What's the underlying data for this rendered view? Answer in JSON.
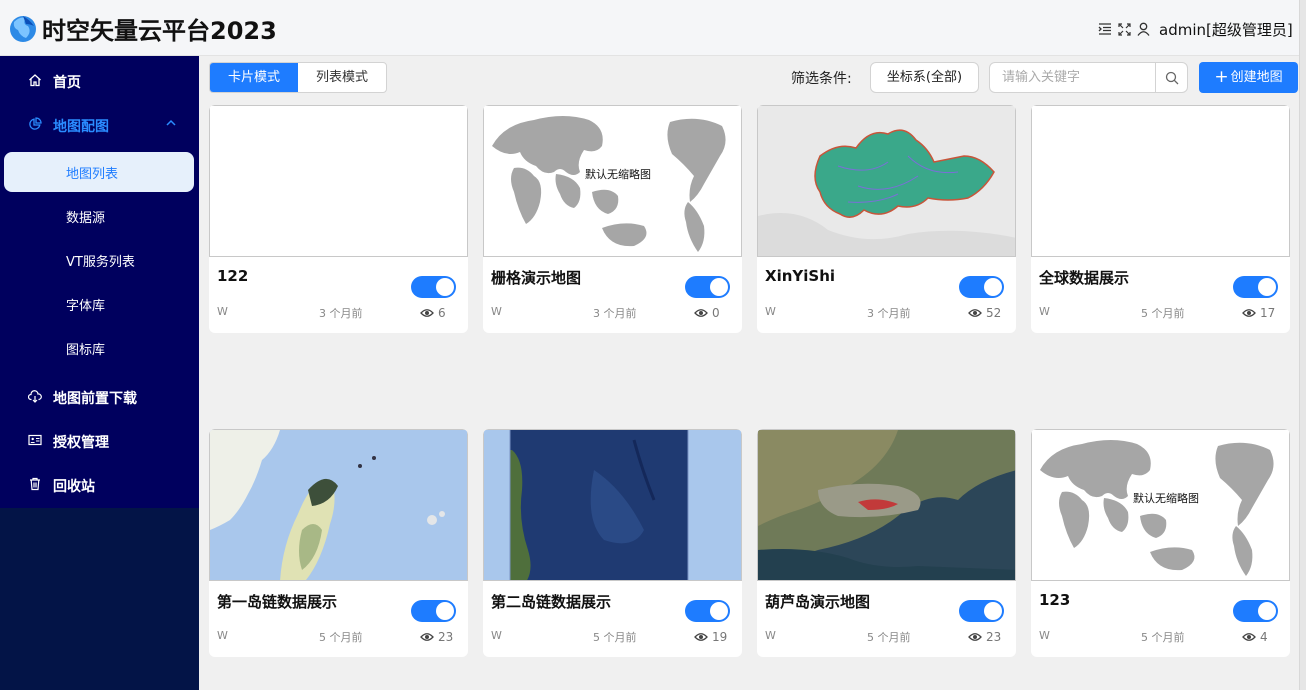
{
  "header": {
    "title": "时空矢量云平台2023",
    "user": "admin[超级管理员]"
  },
  "sidebar": {
    "items": [
      {
        "label": "首页"
      },
      {
        "label": "地图配图"
      },
      {
        "label": "地图前置下载"
      },
      {
        "label": "授权管理"
      },
      {
        "label": "回收站"
      }
    ],
    "subitems": [
      {
        "label": "地图列表"
      },
      {
        "label": "数据源"
      },
      {
        "label": "VT服务列表"
      },
      {
        "label": "字体库"
      },
      {
        "label": "图标库"
      }
    ]
  },
  "toolbar": {
    "mode_card": "卡片模式",
    "mode_list": "列表模式",
    "filter_label": "筛选条件:",
    "coord_select": "坐标系(全部)",
    "search_placeholder": "请输入关键字",
    "create_label": "创建地图"
  },
  "cards": [
    {
      "name": "122",
      "owner": "W",
      "time": "3 个月前",
      "views": "6",
      "enabled": true,
      "thumb": "blank"
    },
    {
      "name": "栅格演示地图",
      "owner": "W",
      "time": "3 个月前",
      "views": "0",
      "enabled": true,
      "thumb": "world",
      "thumb_label": "默认无缩略图"
    },
    {
      "name": "XinYiShi",
      "owner": "W",
      "time": "3 个月前",
      "views": "52",
      "enabled": true,
      "thumb": "region"
    },
    {
      "name": "全球数据展示",
      "owner": "W",
      "time": "5 个月前",
      "views": "17",
      "enabled": true,
      "thumb": "blank"
    },
    {
      "name": "第一岛链数据展示",
      "owner": "W",
      "time": "5 个月前",
      "views": "23",
      "enabled": true,
      "thumb": "island1"
    },
    {
      "name": "第二岛链数据展示",
      "owner": "W",
      "time": "5 个月前",
      "views": "19",
      "enabled": true,
      "thumb": "island2"
    },
    {
      "name": "葫芦岛演示地图",
      "owner": "W",
      "time": "5 个月前",
      "views": "23",
      "enabled": true,
      "thumb": "satellite"
    },
    {
      "name": "123",
      "owner": "W",
      "time": "5 个月前",
      "views": "4",
      "enabled": true,
      "thumb": "world",
      "thumb_label": "默认无缩略图"
    }
  ],
  "colors": {
    "accent": "#1e7cff",
    "sidebar_menu": "#00005e",
    "sidebar_bg": "#031447",
    "page_bg": "#f0f0f0"
  }
}
